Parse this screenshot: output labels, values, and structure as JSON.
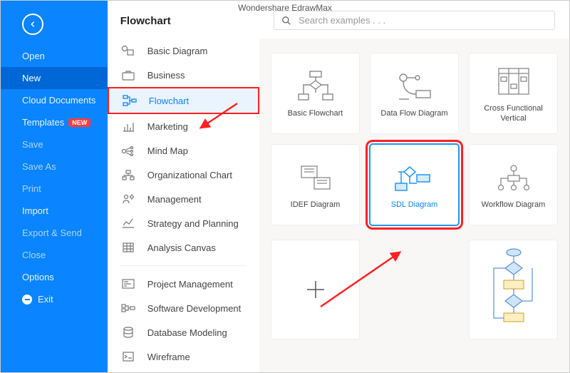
{
  "app_title": "Wondershare EdrawMax",
  "sidebar": {
    "open": "Open",
    "new": "New",
    "cloud": "Cloud Documents",
    "templates": "Templates",
    "templates_badge": "NEW",
    "save": "Save",
    "saveas": "Save As",
    "print": "Print",
    "import": "Import",
    "export": "Export & Send",
    "close": "Close",
    "options": "Options",
    "exit": "Exit"
  },
  "categories": {
    "title": "Flowchart",
    "basic": "Basic Diagram",
    "business": "Business",
    "flowchart": "Flowchart",
    "marketing": "Marketing",
    "mindmap": "Mind Map",
    "org": "Organizational Chart",
    "mgmt": "Management",
    "strategy": "Strategy and Planning",
    "analysis": "Analysis Canvas",
    "pm": "Project Management",
    "swdev": "Software Development",
    "db": "Database Modeling",
    "wire": "Wireframe"
  },
  "search": {
    "placeholder": "Search examples . . ."
  },
  "templates": {
    "basic_flow": "Basic Flowchart",
    "dataflow": "Data Flow Diagram",
    "crossfunc": "Cross Functional Vertical",
    "idef": "IDEF Diagram",
    "sdl": "SDL Diagram",
    "workflow": "Workflow Diagram"
  }
}
